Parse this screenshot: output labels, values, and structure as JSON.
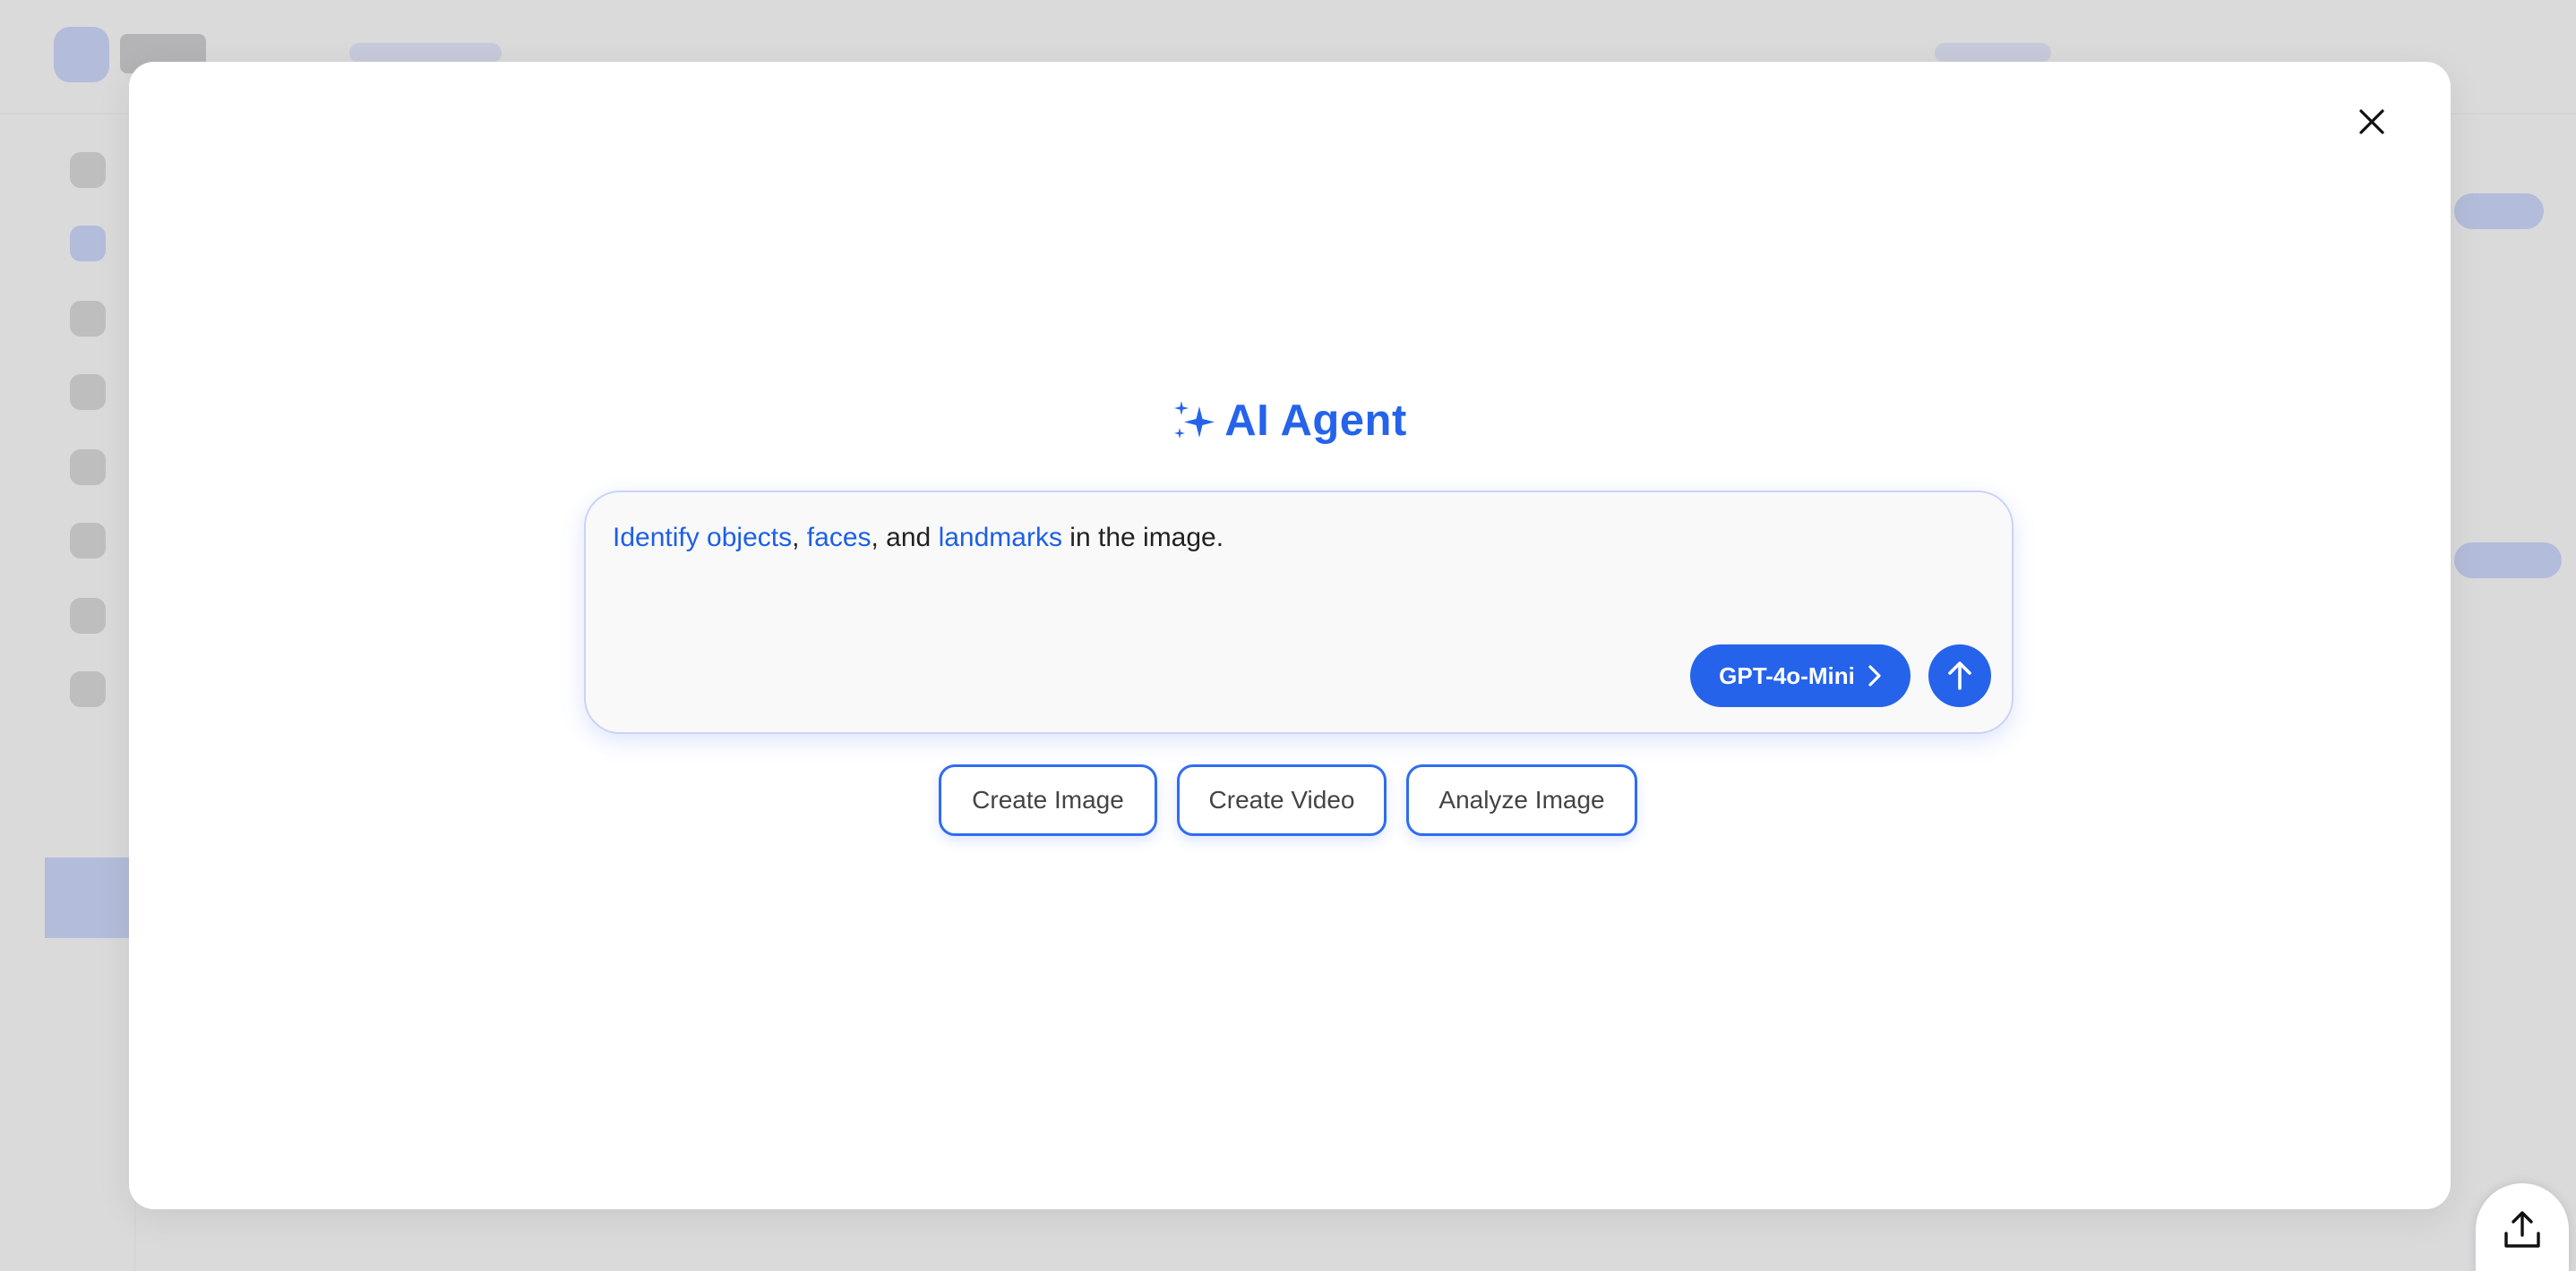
{
  "modal": {
    "title": "AI Agent",
    "close_icon": "close-icon",
    "title_icon": "sparkles-icon"
  },
  "prompt": {
    "segments": [
      {
        "text": "Identify objects",
        "highlight": true
      },
      {
        "text": ", ",
        "highlight": false
      },
      {
        "text": "faces",
        "highlight": true
      },
      {
        "text": ", and ",
        "highlight": false
      },
      {
        "text": "landmarks",
        "highlight": true
      },
      {
        "text": " in the image.",
        "highlight": false
      }
    ],
    "model_label": "GPT-4o-Mini",
    "model_icon": "chevron-right-icon",
    "send_icon": "arrow-up-icon"
  },
  "suggestions": [
    {
      "label": "Create Image"
    },
    {
      "label": "Create Video"
    },
    {
      "label": "Analyze Image"
    }
  ],
  "floating": {
    "share_icon": "upload-icon"
  },
  "colors": {
    "accent": "#2563eb",
    "highlight_text": "#1d5fe6",
    "overlay": "#d2d2d4"
  }
}
